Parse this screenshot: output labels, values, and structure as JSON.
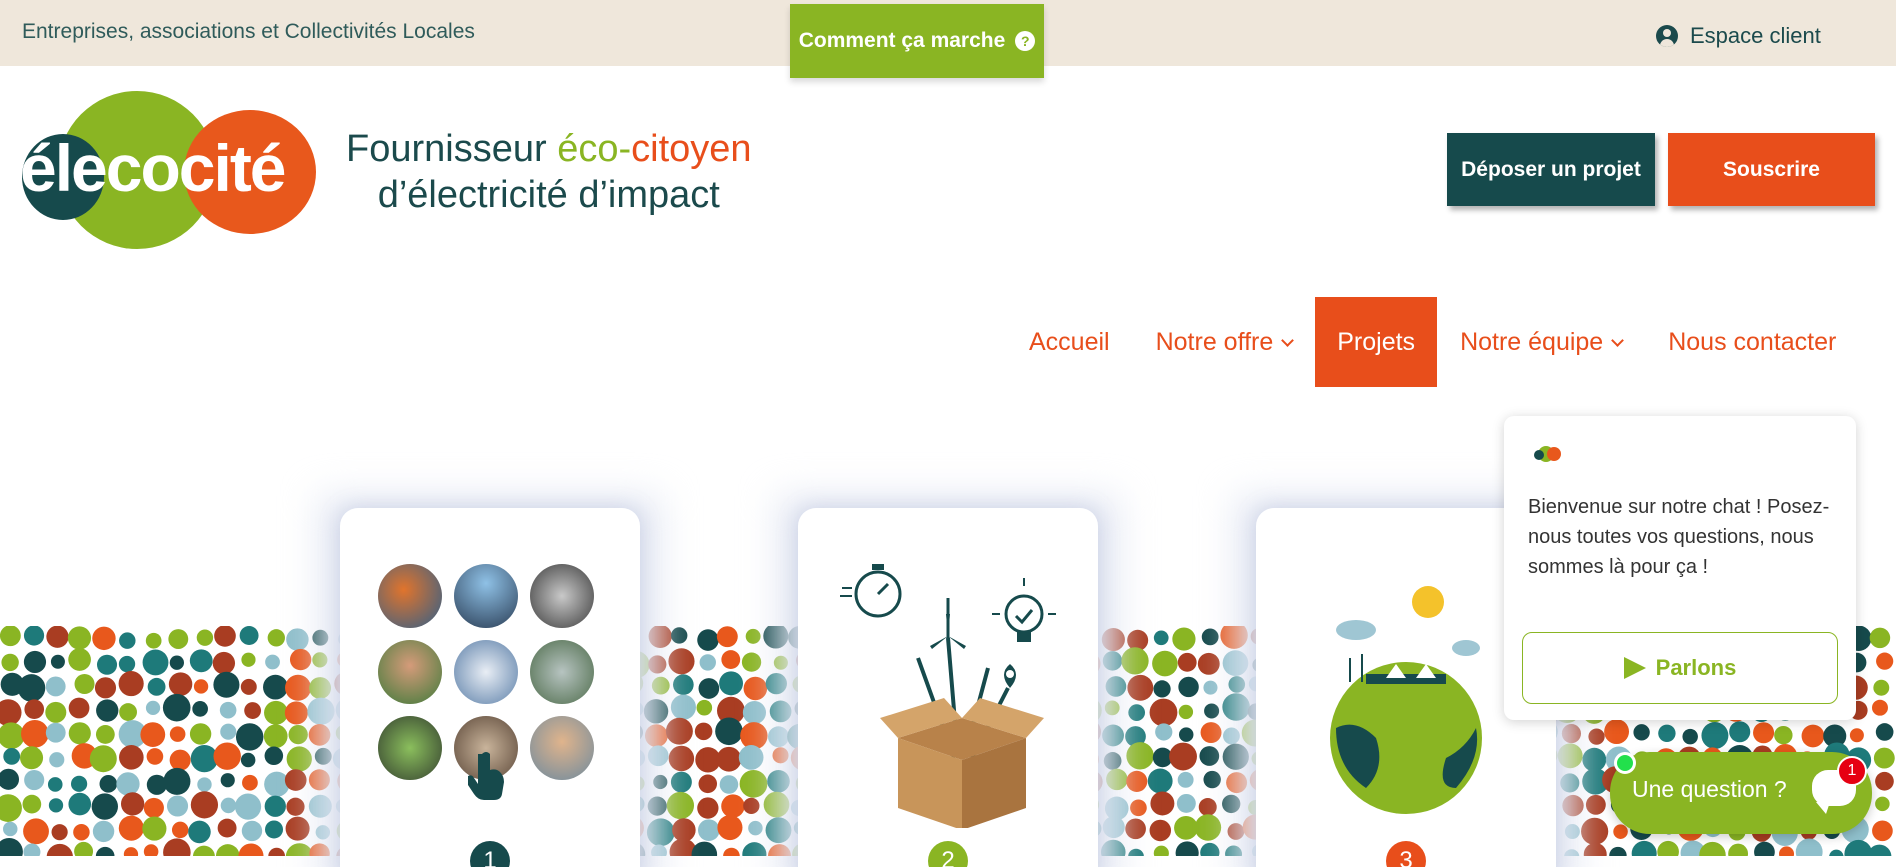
{
  "topbar": {
    "tagline": "Entreprises, associations et Collectivités Locales",
    "howto_label": "Comment ça marche",
    "howto_icon": "?",
    "client_label": "Espace client"
  },
  "logo": {
    "text": "élecocité"
  },
  "slogan": {
    "part1": "Fournisseur ",
    "part2": "éco-",
    "part3": "citoyen",
    "line2": "d’électricité d’impact"
  },
  "actions": {
    "deposit_label": "Déposer un projet",
    "subscribe_label": "Souscrire"
  },
  "nav": {
    "items": [
      {
        "label": "Accueil"
      },
      {
        "label": "Notre offre"
      },
      {
        "label": "Projets"
      },
      {
        "label": "Notre équipe"
      },
      {
        "label": "Nous contacter"
      }
    ],
    "active": "Projets"
  },
  "steps": [
    {
      "number": "1"
    },
    {
      "number": "2"
    },
    {
      "number": "3"
    }
  ],
  "chat": {
    "message": "Bienvenue sur notre chat ! Posez-nous toutes vos questions, nous sommes là pour ça !",
    "button_label": "Parlons",
    "launcher_label": "Une question ?",
    "unread_count": "1"
  },
  "colors": {
    "green": "#8ab523",
    "orange": "#e84e1b",
    "teal": "#164a4c",
    "topbar_bg": "#efe7db"
  }
}
